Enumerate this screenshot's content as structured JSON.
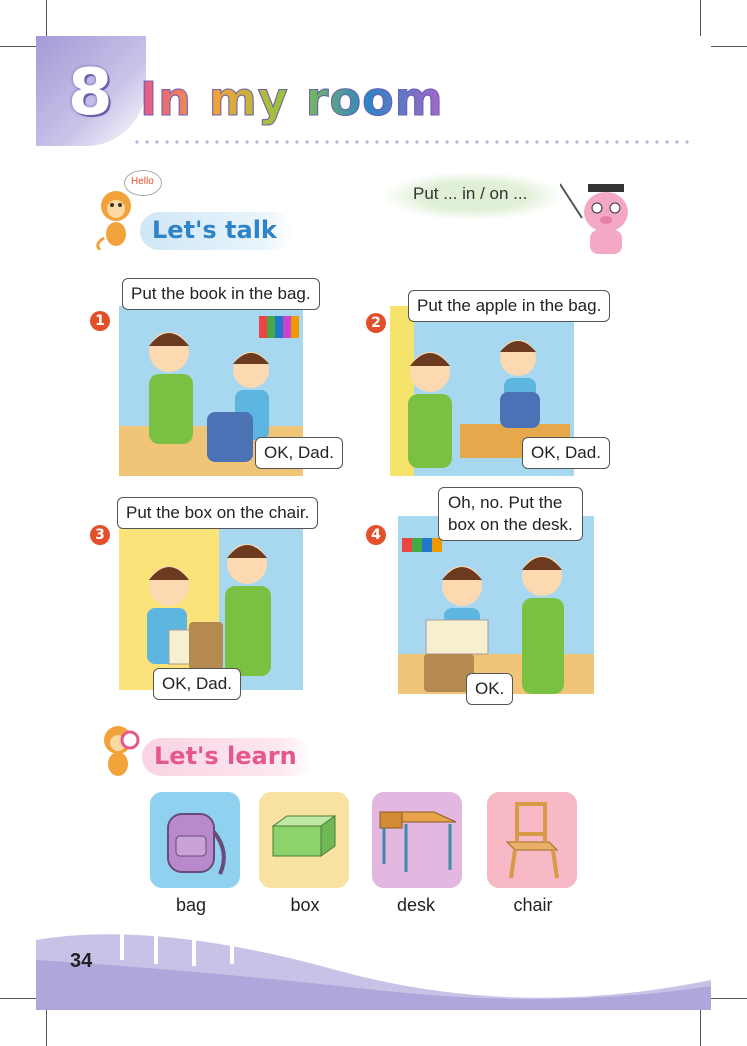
{
  "unit": {
    "number": "8",
    "title": "In my room"
  },
  "sections": {
    "talk": "Let's talk",
    "learn": "Let's learn"
  },
  "mascot": {
    "hello": "Hello"
  },
  "tip": {
    "text": "Put ... in / on ..."
  },
  "panels": [
    {
      "number": "1",
      "speech_top": "Put the book in the bag.",
      "speech_bottom": "OK, Dad."
    },
    {
      "number": "2",
      "speech_top": "Put the apple in the bag.",
      "speech_bottom": "OK, Dad."
    },
    {
      "number": "3",
      "speech_top": "Put the box on the chair.",
      "speech_bottom": "OK, Dad."
    },
    {
      "number": "4",
      "speech_top_line1": "Oh, no. Put the",
      "speech_top_line2": "box on the desk.",
      "speech_bottom": "OK."
    }
  ],
  "vocab": [
    {
      "word": "bag",
      "color": "#8fd1ef"
    },
    {
      "word": "box",
      "color": "#f8e3a3"
    },
    {
      "word": "desk",
      "color": "#e3b7df"
    },
    {
      "word": "chair",
      "color": "#f6b9c5"
    }
  ],
  "page_number": "34"
}
